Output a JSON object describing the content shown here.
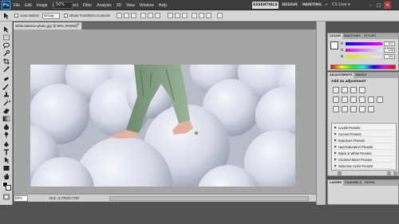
{
  "app": {
    "logo": "Ps",
    "zoom": "50%",
    "workspaces": [
      "ESSENTIALS",
      "DESIGN",
      "PAINTING",
      "»"
    ],
    "cs_live": "CS Live ▾",
    "window_buttons": [
      "–",
      "□",
      "×"
    ]
  },
  "menu": [
    "File",
    "Edit",
    "Image",
    "Layer",
    "Select",
    "Filter",
    "Analysis",
    "3D",
    "View",
    "Window",
    "Help"
  ],
  "options_bar": {
    "auto_select_label": "Auto-Select:",
    "auto_select_value": "Group",
    "transform_label": "Show Transform Controls"
  },
  "document": {
    "tab_title": "white-balance-photo.jpg @ 50% (RGB/8)",
    "close": "×"
  },
  "status": {
    "zoom": "50%",
    "doc_info": "Doc: 3.77M/3.77M"
  },
  "panels": {
    "color_tabs": [
      "COLOR",
      "SWATCHES",
      "STYLES"
    ],
    "sliders": [
      {
        "label": "R",
        "value": "227"
      },
      {
        "label": "G",
        "value": "228"
      },
      {
        "label": "B",
        "value": "241"
      }
    ],
    "adjust_tabs": [
      "ADJUSTMENTS",
      "MASKS"
    ],
    "adjust_title": "Add an adjustment",
    "presets": [
      "Levels Presets",
      "Curves Presets",
      "Exposure Presets",
      "Hue/Saturation Presets",
      "Black & White Presets",
      "Channel Mixer Presets",
      "Selective Color Presets"
    ],
    "layers_tabs": [
      "LAYERS",
      "CHANNELS",
      "PATHS"
    ]
  },
  "colors": {
    "ui_dark": "#3c3c3c",
    "panel_bg": "#d6d6d6",
    "canvas_bg": "#a5a5a5",
    "workspace_active": "#d9d9d9"
  }
}
